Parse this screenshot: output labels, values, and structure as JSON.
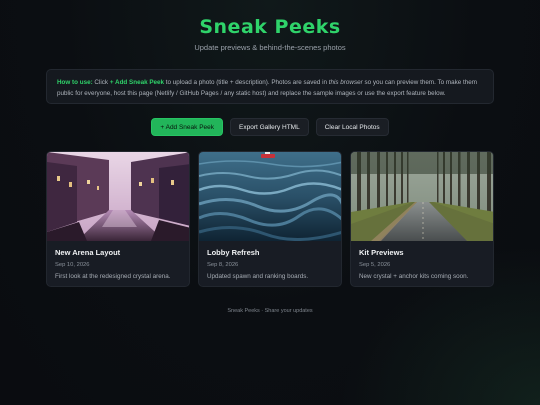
{
  "header": {
    "title": "Sneak Peeks",
    "subtitle": "Update previews & behind-the-scenes photos"
  },
  "help": {
    "lead": "How to use:",
    "t1": " Click ",
    "action": "+ Add Sneak Peek",
    "t2": " to upload a photo (title + description). Photos are saved in ",
    "emph": "this browser",
    "t3": " so you can preview them. To make them public for everyone, host this page (Netlify / GitHub Pages / any static host) and replace the sample images or use the export feature below."
  },
  "toolbar": {
    "add_label": "+ Add Sneak Peek",
    "export_label": "Export Gallery HTML",
    "clear_label": "Clear Local Photos"
  },
  "cards": [
    {
      "title": "New Arena Layout",
      "date": "Sep 10, 2026",
      "desc": "First look at the redesigned crystal arena.",
      "image": "canal-city-photo"
    },
    {
      "title": "Lobby Refresh",
      "date": "Sep 8, 2026",
      "desc": "Updated spawn and ranking boards.",
      "image": "ocean-boat-photo"
    },
    {
      "title": "Kit Previews",
      "date": "Sep 5, 2026",
      "desc": "New crystal + anchor kits coming soon.",
      "image": "forest-road-photo"
    }
  ],
  "footer": {
    "text": "Sneak Peeks · Share your updates"
  },
  "colors": {
    "accent": "#2fd36a",
    "primary_button": "#22b55a",
    "background": "#0b0e12",
    "card": "#181c24"
  }
}
